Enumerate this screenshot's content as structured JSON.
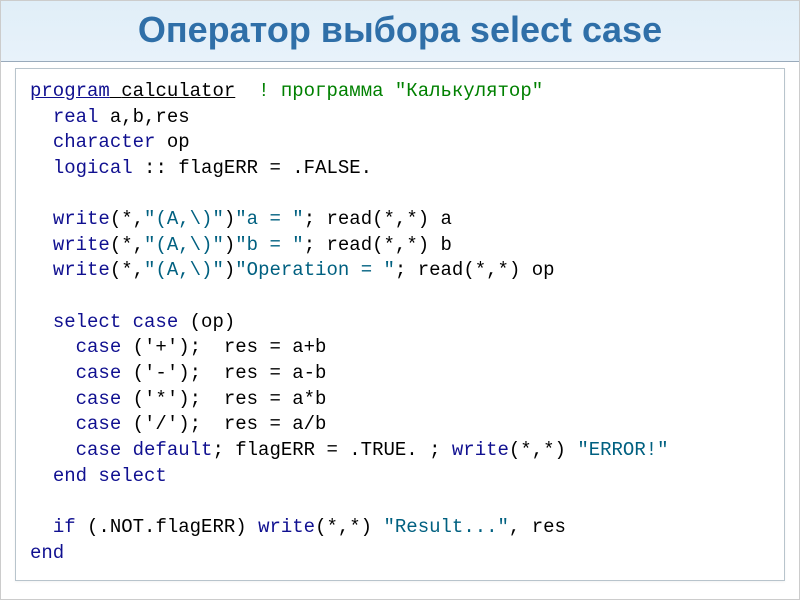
{
  "title": "Оператор выбора select case",
  "code": {
    "kw_program": "program",
    "prog_name": "calculator",
    "comment1": "! программа \"Калькулятор\"",
    "kw_real": "real",
    "vars_real": "a,b,res",
    "kw_character": "character",
    "vars_char": "op",
    "kw_logical": "logical",
    "logical_rest": " :: flagERR = .FALSE.",
    "kw_write": "write",
    "w_args": "(*,",
    "fmt": "\"(A,\\)\"",
    "w_close": ")",
    "str_a": "\"a = \"",
    "read_a": "; read(*,*) a",
    "str_b": "\"b = \"",
    "read_b": "; read(*,*) b",
    "str_op": "\"Operation = \"",
    "read_op": "; read(*,*) op",
    "kw_select_case": "select case",
    "sel_expr": " (op)",
    "kw_case": "case",
    "case_plus_arg": " ('+');  res = a+b",
    "case_minus_arg": " ('-');  res = a-b",
    "case_mul_arg": " ('*');  res = a*b",
    "case_div_arg": " ('/');  res = a/b",
    "kw_case_default": "case default",
    "default_mid": "; flagERR = .TRUE. ; ",
    "default_writecall": "(*,*) ",
    "str_error": "\"ERROR!\"",
    "kw_end_select": "end select",
    "kw_if": "if",
    "if_cond": " (.NOT.flagERR) ",
    "if_writeargs": "(*,*) ",
    "str_result": "\"Result...\"",
    "if_tail": ", res",
    "kw_end": "end"
  }
}
